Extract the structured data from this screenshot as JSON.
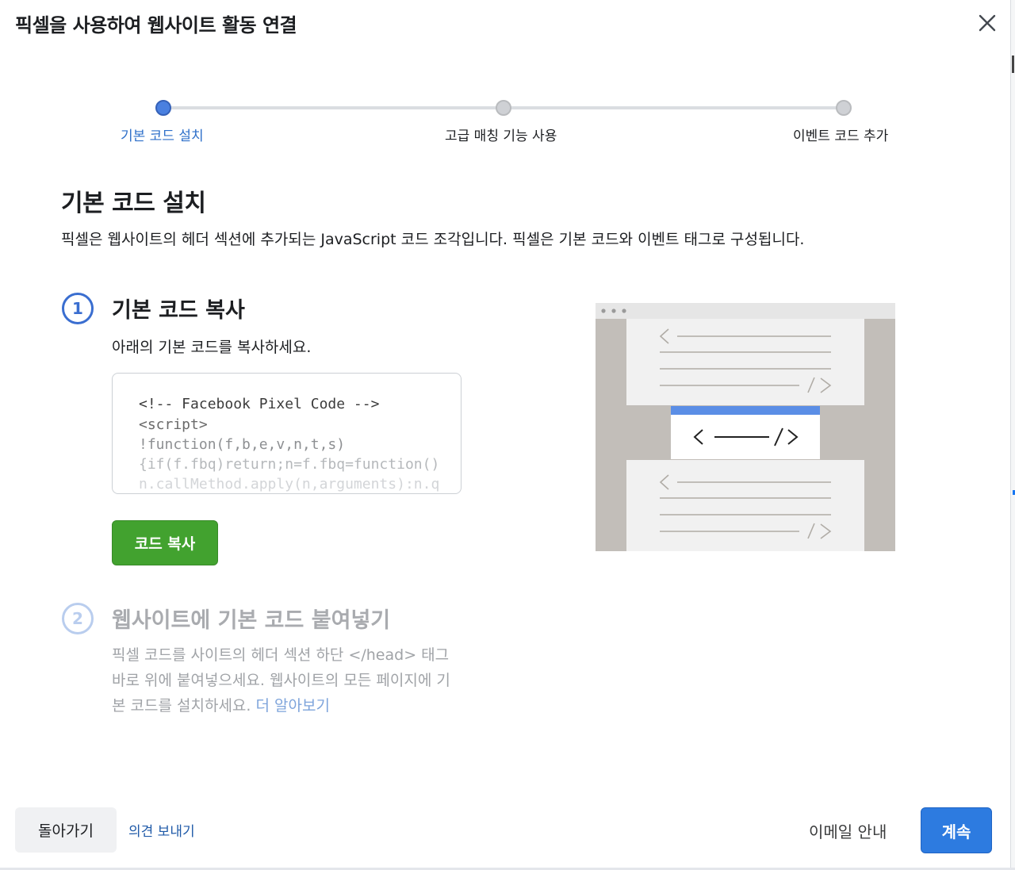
{
  "modal": {
    "title": "픽셀을 사용하여 웹사이트 활동 연결",
    "close_icon": "close-icon"
  },
  "stepper": {
    "steps": [
      {
        "label": "기본 코드 설치",
        "state": "active"
      },
      {
        "label": "고급 매칭 기능 사용",
        "state": "inactive"
      },
      {
        "label": "이벤트 코드 추가",
        "state": "inactive"
      }
    ]
  },
  "section": {
    "title": "기본 코드 설치",
    "description": "픽셀은 웹사이트의 헤더 섹션에 추가되는 JavaScript 코드 조각입니다. 픽셀은 기본 코드와 이벤트 태그로 구성됩니다."
  },
  "step1": {
    "number": "1",
    "title": "기본 코드 복사",
    "description": "아래의 기본 코드를 복사하세요.",
    "code_lines": [
      "<!-- Facebook Pixel Code -->",
      "<script>",
      "!function(f,b,e,v,n,t,s)",
      "{if(f.fbq)return;n=f.fbq=function()",
      "n.callMethod.apply(n,arguments):n.q"
    ],
    "copy_button": "코드 복사"
  },
  "step2": {
    "number": "2",
    "title": "웹사이트에 기본 코드 붙여넣기",
    "description": "픽셀 코드를 사이트의 헤더 섹션 하단 </head> 태그 바로 위에 붙여넣으세요. 웹사이트의 모든 페이지에 기본 코드를 설치하세요.",
    "learn_more": "더 알아보기"
  },
  "footer": {
    "back_button": "돌아가기",
    "feedback_link": "의견 보내기",
    "email_link": "이메일 안내",
    "continue_button": "계속"
  },
  "colors": {
    "primary": "#2d7be0",
    "success": "#42a22f",
    "link": "#1f5aa8",
    "step_active": "#4a80e0"
  }
}
